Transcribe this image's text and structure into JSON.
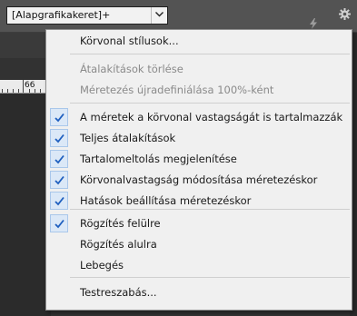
{
  "toolbar": {
    "style_select_value": "[Alapgrafikakeret]+",
    "icons": [
      "chevron-down-icon",
      "lightning-icon",
      "gear-icon"
    ]
  },
  "ruler": {
    "label": "66"
  },
  "menu": {
    "items": [
      {
        "label": "Körvonal stílusok...",
        "enabled": true,
        "checked": false
      },
      {
        "label": "Átalakítások törlése",
        "enabled": false,
        "checked": false
      },
      {
        "label": "Méretezés újradefiniálása 100%-ként",
        "enabled": false,
        "checked": false
      },
      {
        "label": "A méretek a körvonal vastagságát is tartalmazzák",
        "enabled": true,
        "checked": true
      },
      {
        "label": "Teljes átalakítások",
        "enabled": true,
        "checked": true
      },
      {
        "label": "Tartalomeltolás megjelenítése",
        "enabled": true,
        "checked": true
      },
      {
        "label": "Körvonalvastagság módosítása méretezéskor",
        "enabled": true,
        "checked": true
      },
      {
        "label": "Hatások beállítása méretezéskor",
        "enabled": true,
        "checked": true
      },
      {
        "label": "Rögzítés felülre",
        "enabled": true,
        "checked": true
      },
      {
        "label": "Rögzítés alulra",
        "enabled": true,
        "checked": false
      },
      {
        "label": "Lebegés",
        "enabled": true,
        "checked": false
      },
      {
        "label": "Testreszabás...",
        "enabled": true,
        "checked": false
      }
    ]
  },
  "colors": {
    "toolbar_bg": "#535353",
    "menu_bg": "#f0f0f0",
    "check_bg": "#dbe8f7",
    "check_mark": "#1f5fbf",
    "disabled_text": "#8a8a8a"
  }
}
